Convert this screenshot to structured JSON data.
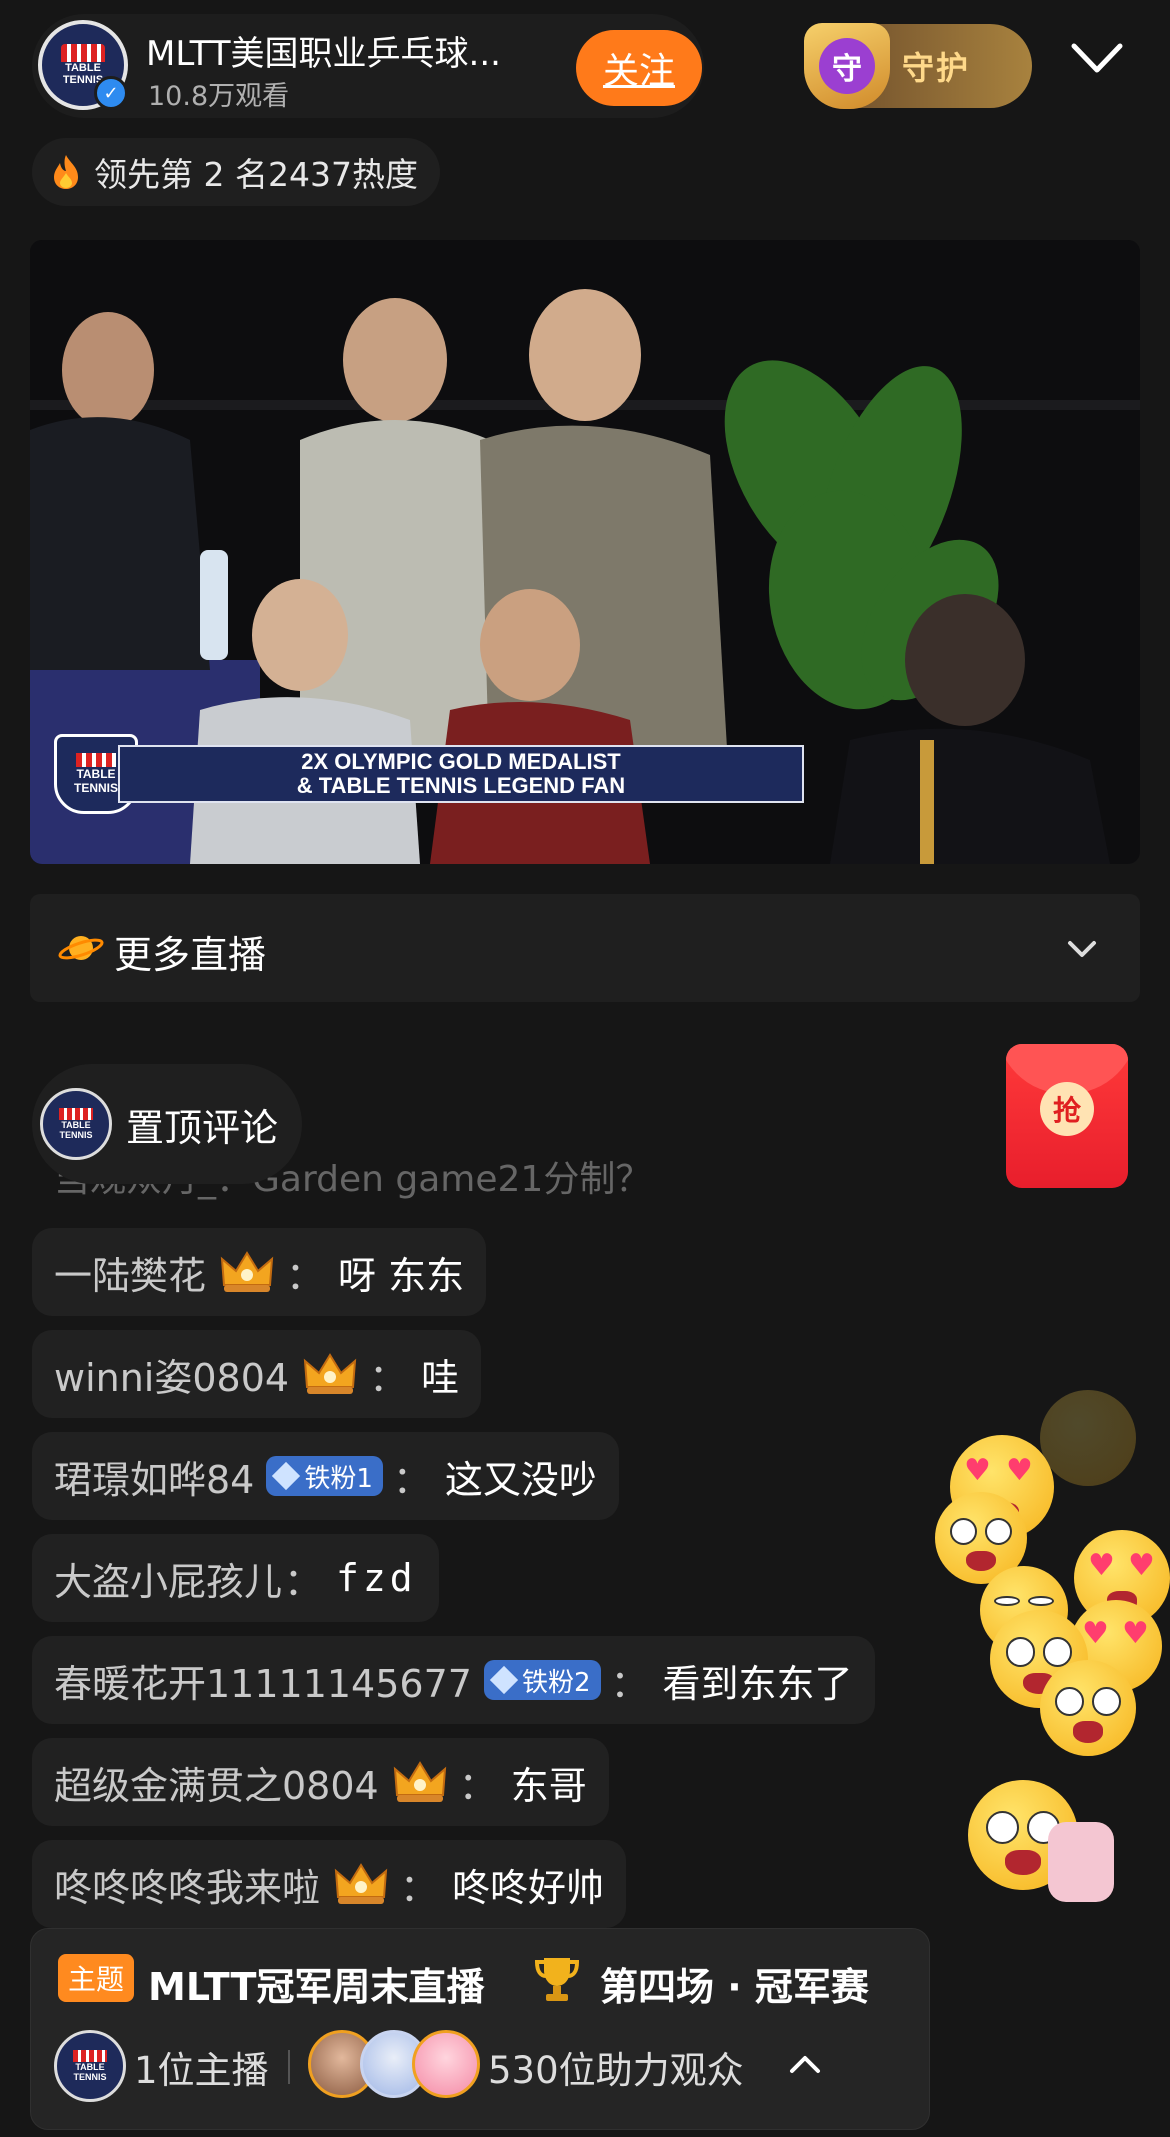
{
  "header": {
    "channel_name": "MLTT美国职业乒乓球...",
    "viewers": "10.8万观看",
    "follow_label": "关注",
    "guard_badge": "守",
    "guard_label": "守护",
    "logo_text_1": "TABLE",
    "logo_text_2": "TENNIS"
  },
  "heat": {
    "text": "领先第 2 名2437热度"
  },
  "video": {
    "banner_line1": "2X OLYMPIC GOLD MEDALIST",
    "banner_line2": "& TABLE TENNIS LEGEND FAN",
    "logo_text_1": "TABLE",
    "logo_text_2": "TENNIS"
  },
  "more_live": {
    "label": "更多直播"
  },
  "pinned": {
    "label": "置顶评论"
  },
  "red_packet": {
    "label": "抢"
  },
  "comments": {
    "faded": "当观众月_：Garden game21分制？",
    "items": [
      {
        "user": "一陆樊花",
        "badge": "crown",
        "text": "呀 东东"
      },
      {
        "user": "winni姿0804",
        "badge": "crown",
        "text": "哇"
      },
      {
        "user": "珺璟如晔84",
        "badge": "fan",
        "fan_label": "铁粉1",
        "text": "这又没吵"
      },
      {
        "user": "大盗小屁孩儿",
        "badge": "",
        "text": "fzd"
      },
      {
        "user": "春暖花开11111145677",
        "badge": "fan",
        "fan_label": "铁粉2",
        "text": "看到东东了"
      },
      {
        "user": "超级金满贯之0804",
        "badge": "crown",
        "text": "东哥"
      },
      {
        "user": "咚咚咚咚我来啦",
        "badge": "crown",
        "text": "咚咚好帅"
      }
    ],
    "colon": "："
  },
  "theme_card": {
    "tag": "主题",
    "title": "MLTT冠军周末直播",
    "title_rest": "第四场 · 冠军赛",
    "hosts": "1位主播",
    "audience": "530位助力观众"
  },
  "colors": {
    "accent_orange": "#ff7a1a",
    "fan_badge_blue": "#3a6ec8",
    "red_packet": "#ff3a3a"
  },
  "icons": [
    "chevron-down-icon",
    "flame-icon",
    "planet-icon",
    "crown-icon",
    "diamond-icon",
    "trophy-icon",
    "chevron-up-icon"
  ]
}
